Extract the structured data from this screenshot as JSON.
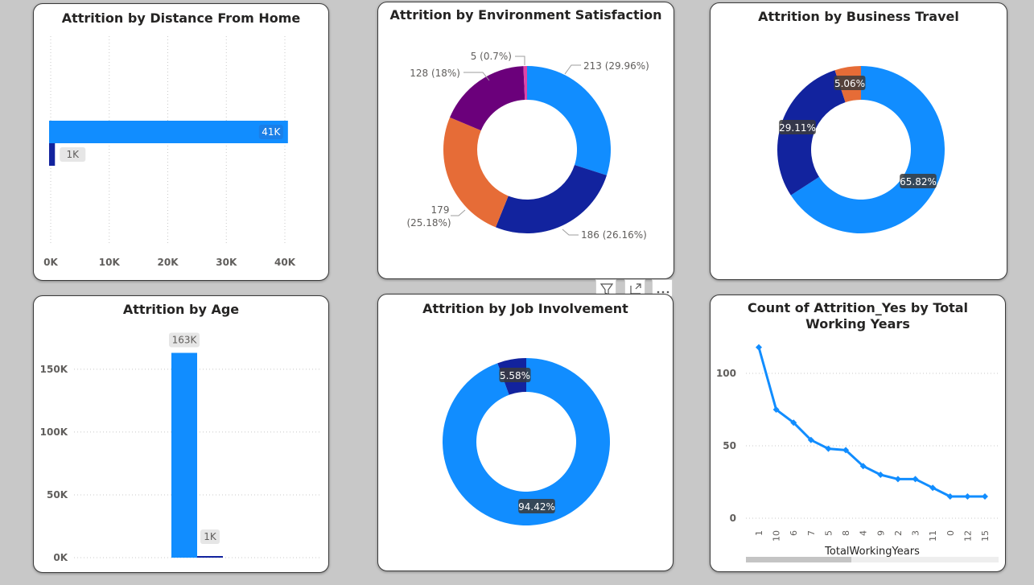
{
  "colors": {
    "blue": "#118dff",
    "navy": "#12239e",
    "orange": "#e66c37",
    "purple": "#6b007b",
    "magenta": "#e044a7",
    "grid": "#c8c8c8",
    "label_bg": "#e6e6e6",
    "dark_label_bg": "#3b3b3b"
  },
  "visual_header": {
    "filter_icon": "filter-icon",
    "focus_icon": "focus-mode-icon",
    "more_icon": "more-options-icon"
  },
  "chart_data": [
    {
      "id": "distance",
      "type": "bar",
      "orientation": "horizontal",
      "title": "Attrition by Distance From Home",
      "categories": [
        "",
        ""
      ],
      "values": [
        41000,
        1000
      ],
      "data_labels": [
        "41K",
        "1K"
      ],
      "colors": [
        "#118dff",
        "#12239e"
      ],
      "xlim": [
        0,
        40000
      ],
      "xticks": [
        "0K",
        "10K",
        "20K",
        "30K",
        "40K"
      ],
      "grid": true
    },
    {
      "id": "env",
      "type": "pie",
      "donut": true,
      "title": "Attrition by Environment Satisfaction",
      "values": [
        213,
        186,
        179,
        128,
        5
      ],
      "colors": [
        "#118dff",
        "#12239e",
        "#e66c37",
        "#6b007b",
        "#e044a7"
      ],
      "labels": [
        [
          "213 (29.96%)"
        ],
        [
          "186 (26.16%)"
        ],
        [
          "179",
          "(25.18%)"
        ],
        [
          "128 (18%)"
        ],
        [
          "5 (0.7%)"
        ]
      ]
    },
    {
      "id": "travel",
      "type": "pie",
      "donut": true,
      "title": "Attrition by Business Travel",
      "values": [
        65.82,
        29.11,
        5.06
      ],
      "colors": [
        "#118dff",
        "#12239e",
        "#e66c37"
      ],
      "labels": [
        "65.82%",
        "29.11%",
        "5.06%"
      ]
    },
    {
      "id": "age",
      "type": "bar",
      "title": "Attrition by Age",
      "categories": [
        "",
        ""
      ],
      "values": [
        163000,
        1000
      ],
      "data_labels": [
        "163K",
        "1K"
      ],
      "colors": [
        "#118dff",
        "#12239e"
      ],
      "ylim": [
        0,
        165000
      ],
      "yticks": [
        {
          "value": 0,
          "label": "0K"
        },
        {
          "value": 50000,
          "label": "50K"
        },
        {
          "value": 100000,
          "label": "100K"
        },
        {
          "value": 150000,
          "label": "150K"
        }
      ],
      "grid": true
    },
    {
      "id": "job",
      "type": "pie",
      "donut": true,
      "title": "Attrition by Job Involvement",
      "values": [
        94.42,
        5.58
      ],
      "colors": [
        "#118dff",
        "#12239e"
      ],
      "labels": [
        "94.42%",
        "5.58%"
      ]
    },
    {
      "id": "years",
      "type": "line",
      "title": "Count of Attrition_Yes by Total Working Years",
      "xlabel": "TotalWorkingYears",
      "categories": [
        "1",
        "10",
        "6",
        "7",
        "5",
        "8",
        "4",
        "9",
        "2",
        "3",
        "11",
        "0",
        "12",
        "15"
      ],
      "values": [
        118,
        75,
        66,
        54,
        48,
        47,
        36,
        30,
        27,
        27,
        21,
        15,
        15,
        15
      ],
      "ylim": [
        0,
        125
      ],
      "yticks": [
        0,
        50,
        100
      ],
      "color": "#118dff",
      "grid": true
    }
  ]
}
